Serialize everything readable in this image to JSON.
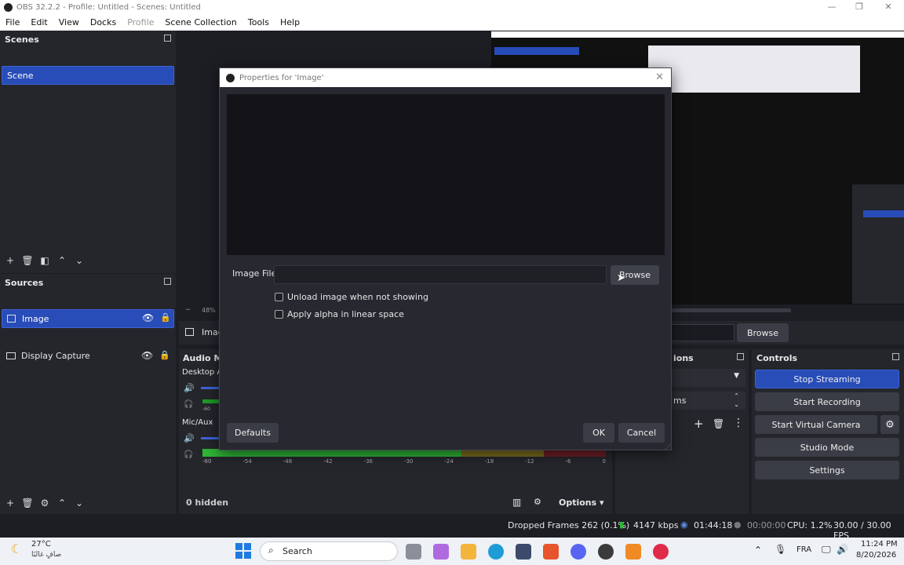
{
  "window": {
    "title": "OBS 32.2.2 - Profile: Untitled - Scenes: Untitled",
    "minimize": "—",
    "maximize": "❐",
    "close": "✕"
  },
  "menu": [
    "File",
    "Edit",
    "View",
    "Docks",
    "Profile",
    "Scene Collection",
    "Tools",
    "Help"
  ],
  "scenes": {
    "header": "Scenes",
    "items": [
      "Scene"
    ]
  },
  "sources": {
    "header": "Sources",
    "items": [
      "Image",
      "Display Capture"
    ]
  },
  "preview": {
    "zoom": "48%",
    "minus": "−"
  },
  "source_toolbar": {
    "name": "Imag",
    "browse": "Browse"
  },
  "audio_mixer": {
    "header": "Audio Mi",
    "channels": [
      {
        "name": "Desktop Au"
      },
      {
        "name": "Mic/Aux"
      }
    ],
    "ticks": [
      "-60",
      "-54",
      "-48",
      "-42",
      "-36",
      "-30",
      "-24",
      "-18",
      "-12",
      "-6",
      "0"
    ],
    "tick_short": "-60"
  },
  "transitions": {
    "header": "ions",
    "duration_suffix": "ms"
  },
  "controls": {
    "header": "Controls",
    "stop_streaming": "Stop Streaming",
    "start_recording": "Start Recording",
    "start_virtual_camera": "Start Virtual Camera",
    "studio_mode": "Studio Mode",
    "settings": "Settings"
  },
  "bottom_bar": {
    "hidden": "0 hidden",
    "options": "Options ▾"
  },
  "dialog": {
    "title": "Properties for 'Image'",
    "image_file_label": "Image File",
    "image_file_value": "",
    "browse": "Browse",
    "unload_label": "Unload image when not showing",
    "unload_checked": false,
    "alpha_label": "Apply alpha in linear space",
    "alpha_checked": false,
    "defaults": "Defaults",
    "ok": "OK",
    "cancel": "Cancel"
  },
  "status": {
    "dropped_frames": "Dropped Frames 262 (0.1%)",
    "bitrate": "4147 kbps",
    "stream_time": "01:44:18",
    "rec_time": "00:00:00",
    "cpu": "CPU: 1.2%",
    "fps": "30.00 / 30.00 FPS"
  },
  "taskbar": {
    "temp": "27°C",
    "weather": "صافٍ غالبًا",
    "search": "Search",
    "lang": "FRA",
    "time": "11:24 PM",
    "date": "8/20/2026"
  },
  "colors": {
    "accent": "#284cb8",
    "bg": "#1d1e24",
    "panel": "#25262c"
  }
}
